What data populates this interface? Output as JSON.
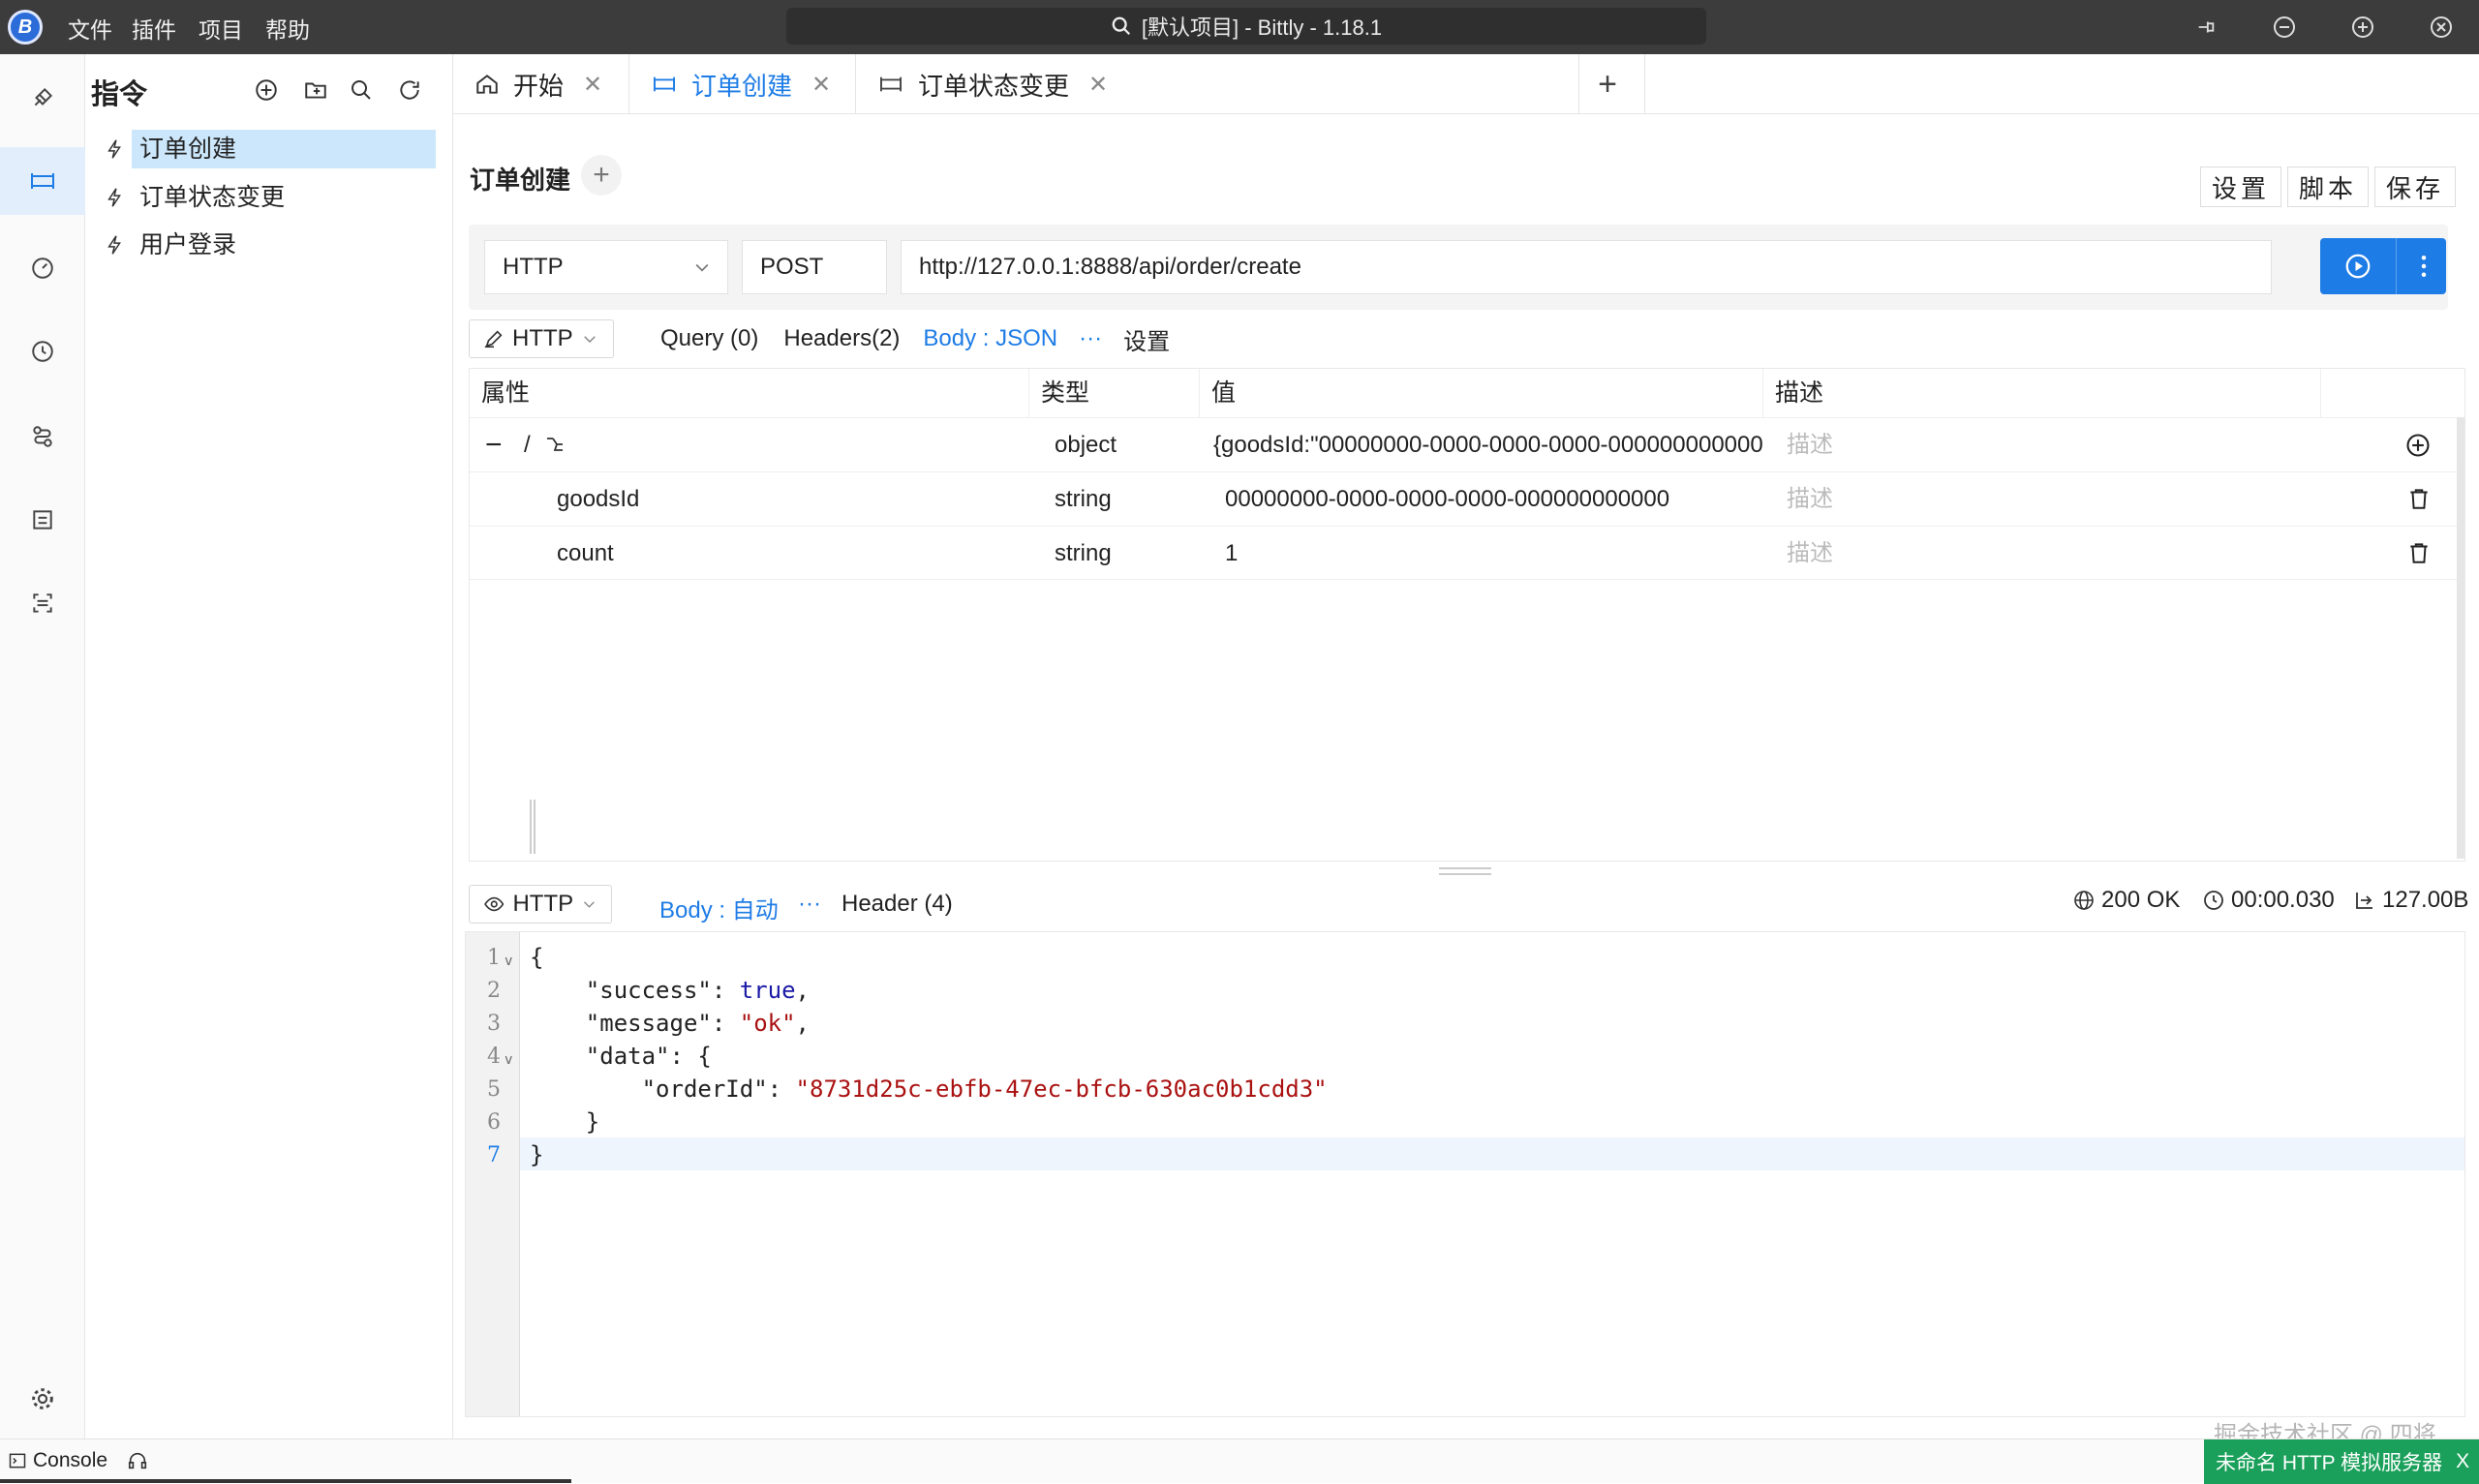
{
  "titlebar": {
    "title": "[默认项目] - Bittly - 1.18.1",
    "logo_text": "B",
    "menu": [
      "文件",
      "插件",
      "项目",
      "帮助"
    ]
  },
  "sidebar": {
    "title": "指令",
    "items": [
      {
        "label": "订单创建",
        "active": true
      },
      {
        "label": "订单状态变更",
        "active": false
      },
      {
        "label": "用户登录",
        "active": false
      }
    ]
  },
  "tabs": [
    {
      "label": "开始",
      "icon": "home-icon"
    },
    {
      "label": "订单创建",
      "icon": "api-icon",
      "active": true
    },
    {
      "label": "订单状态变更",
      "icon": "api-icon"
    }
  ],
  "request": {
    "title": "订单创建",
    "buttons": {
      "settings": "设置",
      "script": "脚本",
      "save": "保存"
    },
    "protocol": "HTTP",
    "method": "POST",
    "url": "http://127.0.0.1:8888/api/order/create"
  },
  "request_tabs": {
    "mode": "HTTP",
    "query": "Query (0)",
    "headers": "Headers(2)",
    "body": "Body : JSON",
    "more": "···",
    "settings": "设置"
  },
  "params": {
    "columns": [
      "属性",
      "类型",
      "值",
      "描述"
    ],
    "rows": [
      {
        "name": "/",
        "type": "object",
        "value": "{goodsId:\"00000000-0000-0000-0000-000000000000",
        "desc": "描述"
      },
      {
        "name": "goodsId",
        "type": "string",
        "value": "00000000-0000-0000-0000-000000000000",
        "desc": "描述"
      },
      {
        "name": "count",
        "type": "string",
        "value": "1",
        "desc": "描述"
      }
    ]
  },
  "response": {
    "mode": "HTTP",
    "body": "Body : 自动",
    "more": "···",
    "header": "Header (4)",
    "status": "200 OK",
    "time": "00:00.030",
    "size": "127.00B",
    "line_numbers": [
      "1",
      "2",
      "3",
      "4",
      "5",
      "6",
      "7"
    ],
    "code": {
      "l1": "{",
      "l2_key": "\"success\"",
      "l2_val": "true",
      "l3_key": "\"message\"",
      "l3_val": "\"ok\"",
      "l4_key": "\"data\"",
      "l4_rest": "{",
      "l5_key": "\"orderId\"",
      "l5_val": "\"8731d25c-ebfb-47ec-bfcb-630ac0b1cdd3\"",
      "l6": "}",
      "l7": "}"
    }
  },
  "statusbar": {
    "console": "Console",
    "mock_server": "未命名 HTTP 模拟服务器",
    "mock_close": "X",
    "watermark": "掘金技术社区 @ 四将"
  },
  "colors": {
    "accent": "#1e7ce6",
    "mock_server_bg": "#1aa05a",
    "titlebar_bg": "#3c3c3c"
  }
}
